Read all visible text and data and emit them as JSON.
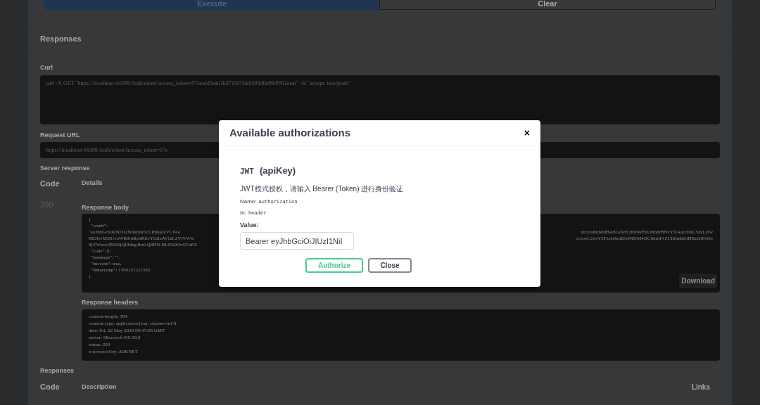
{
  "execute_bar": {
    "execute": "Execute",
    "clear": "Clear"
  },
  "responses_title": "Responses",
  "curl": {
    "label": "Curl",
    "command": "curl -X GET \"https://localhost:44388/Auth/token?access_token=97eeafd5ea01b3719f74fe928440e89d59f2eeaf\" -H \"accept: text/plain\""
  },
  "request_url": {
    "label": "Request URL",
    "value": "https://localhost:44388/Auth/token?access_token=97e"
  },
  "server_response": {
    "label": "Server response",
    "columns": [
      "Code",
      "Details"
    ],
    "code": "200",
    "body_label": "Response body",
    "body_lines": [
      {
        "left": "{"
      },
      {
        "left": "  \"result\":"
      },
      {
        "left": "\"eyJhbGciOiJIUzI1NiIsInR5cCI6IkpXVCJ9.e",
        "right": "xIcyIsImh0dHA6Ly9zY2hlbWFzLmhtbHNvYXAub3JnL3dzLzIw"
      },
      {
        "left": "MDUvMDUvaWRlbnRpdHkvY2xhaW1zL2VtYWls",
        "right": "cczovL2xvY2FsaG9zdDo0NDM4OCIsImF1ZCI6Imh0dHBzOi8vbG"
      },
      {
        "left": "9jYWxob3N0OjQ0Mzg4In0.Q8NN-RL0SOOvSTuEX"
      },
      {
        "left": "  \"code\": 0,"
      },
      {
        "left": "  \"message\": \"\","
      },
      {
        "left": "  \"success\": true,"
      },
      {
        "left": "  \"timestamp\": 1590137227265"
      },
      {
        "left": "}"
      }
    ],
    "download": "Download",
    "headers_label": "Response headers",
    "header_lines": [
      "content-length: 504",
      "content-type: application/json; charset=utf-8",
      "date: Fri, 22 May 2020 08:47:08 GMT",
      "server: Microsoft-IIS/10.0",
      "status: 200",
      "x-powered-by: ASP.NET"
    ]
  },
  "responses_table": {
    "title": "Responses",
    "columns": [
      "Code",
      "Description",
      "Links"
    ]
  },
  "dialog": {
    "title": "Available authorizations",
    "close_symbol": "×",
    "scheme_name": "JWT",
    "scheme_type": "(apiKey)",
    "description": "JWT模式授权，请输入 Bearer (Token) 进行身份验证",
    "name_label": "Name:",
    "name_value": "Authorization",
    "in_label": "In:",
    "in_value": "header",
    "value_label": "Value:",
    "value": "Bearer eyJhbGciOiJIUzI1NiI",
    "authorize": "Authorize",
    "close": "Close"
  }
}
